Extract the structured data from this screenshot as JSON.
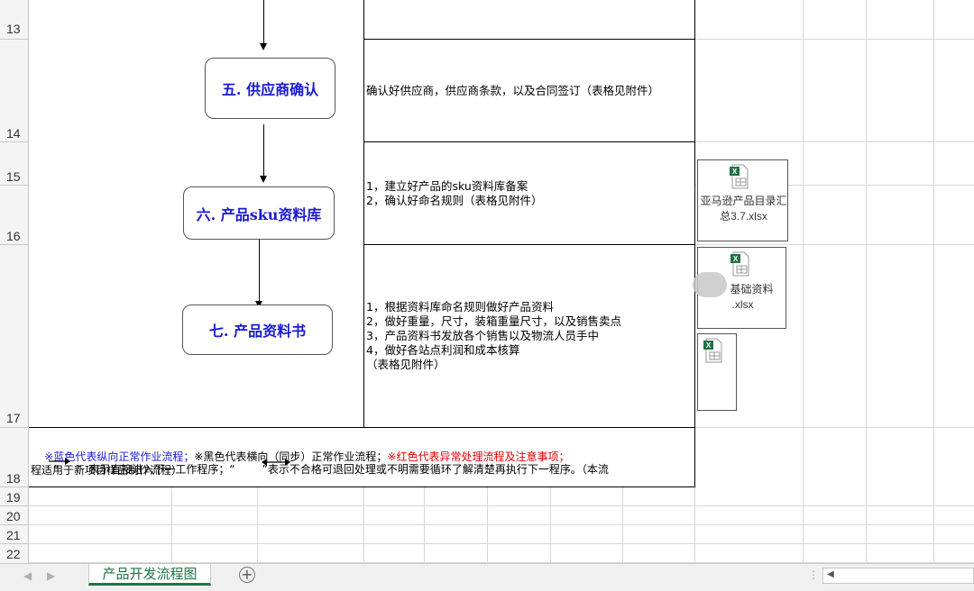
{
  "rows": {
    "r13": "13",
    "r14": "14",
    "r15": "15",
    "r16": "16",
    "r17": "17",
    "r18": "18",
    "r19": "19",
    "r20": "20",
    "r21": "21",
    "r22": "22"
  },
  "steps": [
    {
      "label": "五. 供应商确认",
      "description": "确认好供应商，供应商条款，以及合同签订（表格见附件）"
    },
    {
      "label": "六. 产品sku资料库",
      "description": "1，建立好产品的sku资料库备案\n2，确认好命名规则（表格见附件）"
    },
    {
      "label": "七. 产品资料书",
      "description": "1，根据资料库命名规则做好产品资料\n2，做好重量，尺寸，装箱重量尺寸，以及销售卖点\n3，产品资料书发放各个销售以及物流人员手中\n4，做好各站点利润和成本核算\n（表格见附件）"
    }
  ],
  "attachments": [
    {
      "name": "亚马逊产品目录汇总3.7.xlsx",
      "line1": "亚马逊产品目录汇",
      "line2": "总3.7.xlsx",
      "icon": "excel-file-icon"
    },
    {
      "name": "基础资料.xlsx",
      "line1": "基础资料",
      "line2": ".xlsx",
      "icon": "excel-file-icon"
    },
    {
      "name": "",
      "icon": "excel-file-icon"
    }
  ],
  "note": {
    "blue_part": "※蓝色代表纵向正常作业流程；",
    "black_part": "※黑色代表横向（同步）正常作业流程；",
    "red_part": "※红色代表异常处理流程及注意事项；",
    "line2a": "“     ”  表示直接进入下一工作程序；“",
    "line2b": "”表示不合格可退回处理或不明需要循环了解清楚再执行下一程序。（本流",
    "line3": "程适用于新项目样品制作流程）"
  },
  "colors": {
    "accent_blue": "#1a1ad6",
    "warn_red": "#e00000",
    "excel_green": "#217346"
  },
  "tabbar": {
    "active_sheet": "产品开发流程图",
    "add_icon": "plus-circle-icon"
  }
}
